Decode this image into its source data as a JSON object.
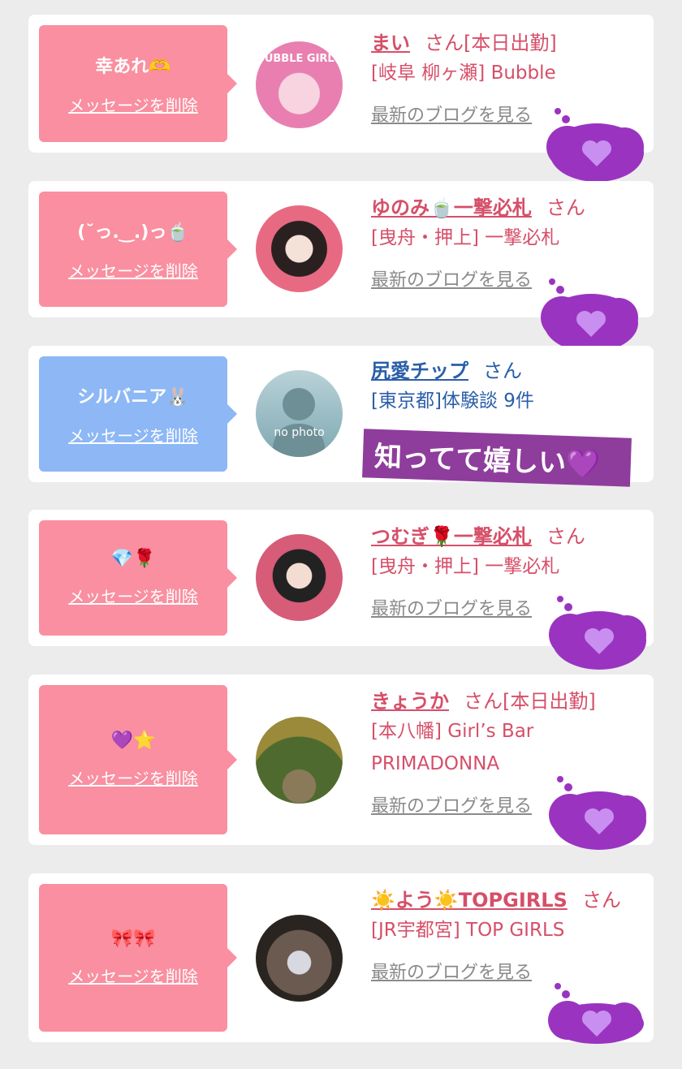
{
  "common": {
    "delete_label": "メッセージを削除",
    "blog_label": "最新のブログを見る",
    "san": "さん"
  },
  "sticker_text": "知ってて嬉しい💜",
  "cards": [
    {
      "message": "幸あれ🫶",
      "name": "まい",
      "status": "[本日出勤]",
      "shop": "[岐阜 柳ヶ瀬] Bubble",
      "avatar_label": "BUBBLE GIRLS"
    },
    {
      "message": "(˘っ.‿.)っ🍵",
      "name": "ゆのみ🍵一撃必札",
      "shop": "[曳舟・押上] 一撃必札"
    },
    {
      "message": "シルバニア🐰",
      "name": "尻愛チップ",
      "shop": "[東京都]体験談 9件",
      "avatar_label": "no photo"
    },
    {
      "message": "💎🌹",
      "name": "つむぎ🌹一撃必札",
      "shop": "[曳舟・押上] 一撃必札"
    },
    {
      "message": "💜⭐",
      "name": "きょうか",
      "status": "[本日出勤]",
      "shop": "[本八幡] Girl’s Bar PRIMADONNA"
    },
    {
      "message": "🎀🎀",
      "name": "☀️よう☀️TOPGIRLS",
      "shop": "[JR宇都宮] TOP GIRLS"
    }
  ]
}
